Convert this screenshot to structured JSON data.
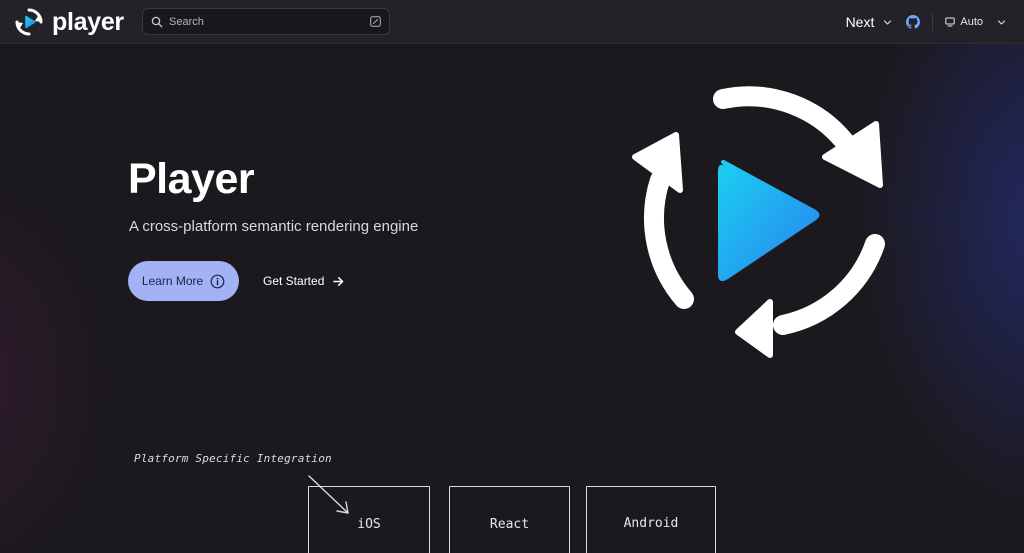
{
  "header": {
    "brand_name": "player",
    "search": {
      "placeholder": "Search"
    },
    "version_label": "Next",
    "theme_label": "Auto"
  },
  "hero": {
    "title": "Player",
    "subtitle": "A cross-platform semantic rendering engine",
    "primary_button": "Learn More",
    "secondary_button": "Get Started"
  },
  "diagram": {
    "caption": "Platform Specific Integration",
    "platforms": [
      "iOS",
      "React",
      "Android"
    ]
  },
  "colors": {
    "background": "#1b191e",
    "navbar": "#232228",
    "accent_button": "#a3b1f5",
    "play_gradient_start": "#1ad2f0",
    "play_gradient_end": "#2a7ff0"
  },
  "icons": {
    "logo": "play-cycle-logo-icon",
    "search": "search-icon",
    "shortcut": "keyboard-shortcut-icon",
    "github": "github-icon",
    "theme": "monitor-icon",
    "info": "info-icon",
    "arrow": "arrow-right-icon"
  }
}
